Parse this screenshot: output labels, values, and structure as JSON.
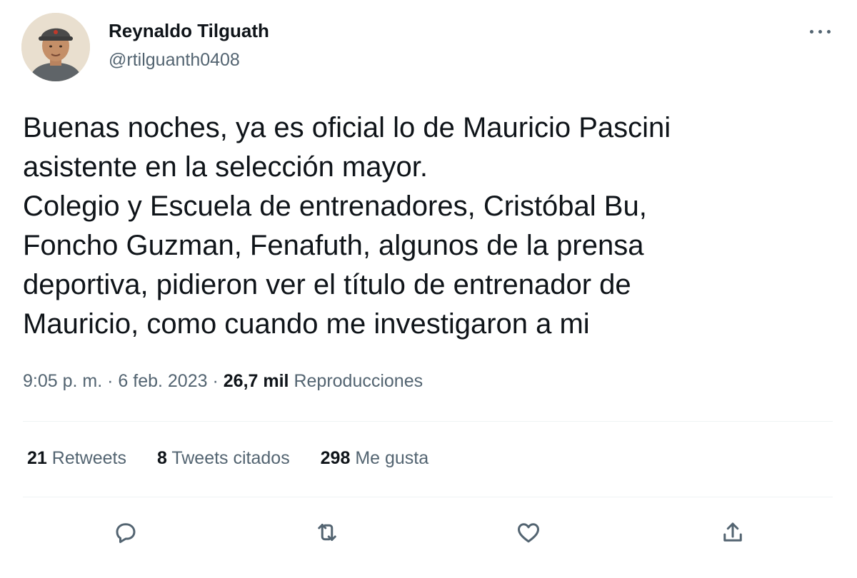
{
  "author": {
    "display_name": "Reynaldo Tilguath",
    "handle": "@rtilguanth0408"
  },
  "tweet": {
    "text": "Buenas noches, ya es oficial lo de Mauricio Pascini\nasistente en la selección mayor.\nColegio y Escuela de entrenadores, Cristóbal Bu,\nFoncho Guzman, Fenafuth, algunos de la prensa\ndeportiva, pidieron ver el título de entrenador de\nMauricio, como cuando me investigaron a mi",
    "time": "9:05 p. m.",
    "separator": "·",
    "date": "6 feb. 2023",
    "views_count": "26,7 mil",
    "views_label": "Reproducciones"
  },
  "stats": {
    "retweets_count": "21",
    "retweets_label": "Retweets",
    "quotes_count": "8",
    "quotes_label": "Tweets citados",
    "likes_count": "298",
    "likes_label": "Me gusta"
  },
  "icons": {
    "reply": "reply-icon",
    "retweet": "retweet-icon",
    "like": "heart-icon",
    "share": "share-icon",
    "more": "more-options-icon"
  },
  "colors": {
    "text_primary": "#0f1419",
    "text_secondary": "#536471",
    "divider": "#eff3f4"
  }
}
